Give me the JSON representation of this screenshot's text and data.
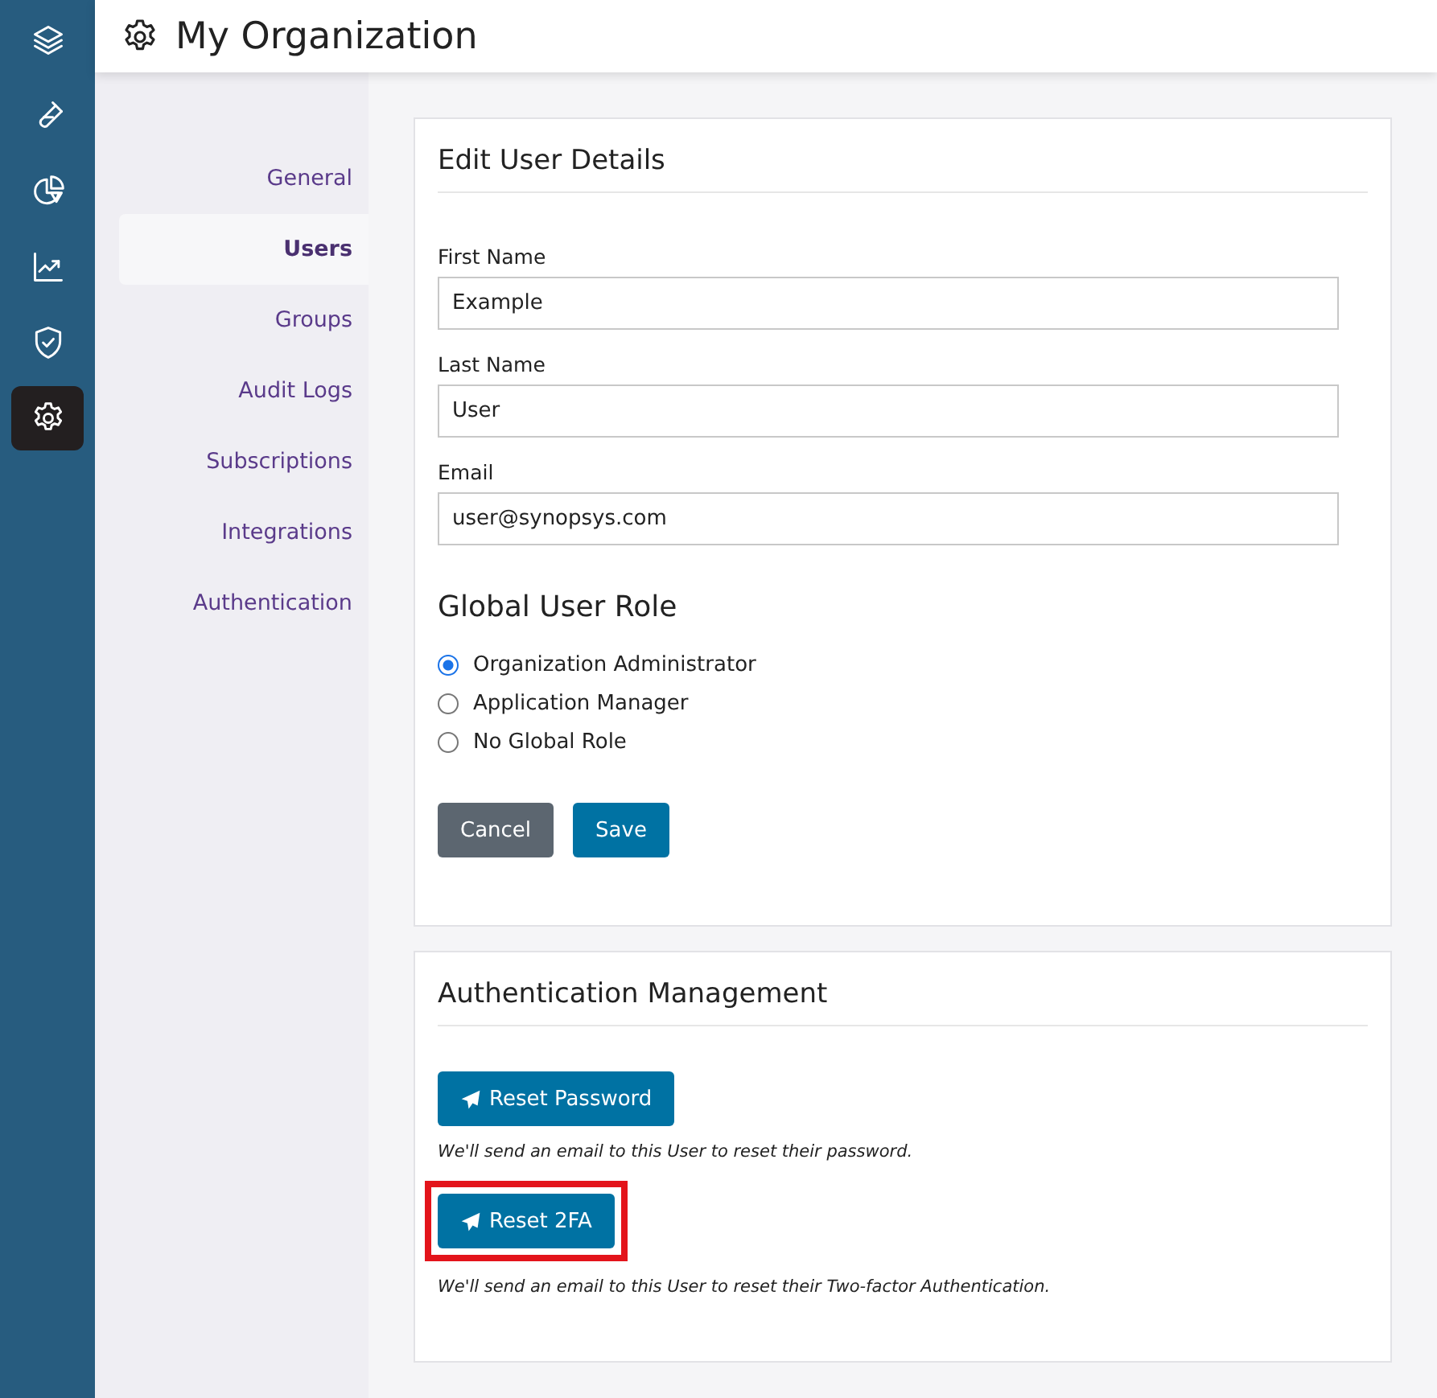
{
  "rail": {
    "items": [
      {
        "kind": "layers",
        "selected": false
      },
      {
        "kind": "flask",
        "selected": false
      },
      {
        "kind": "pie",
        "selected": false
      },
      {
        "kind": "trend",
        "selected": false
      },
      {
        "kind": "shield",
        "selected": false
      },
      {
        "kind": "gear",
        "selected": true
      }
    ]
  },
  "header": {
    "title": "My Organization"
  },
  "subnav": {
    "items": [
      {
        "label": "General",
        "selected": false
      },
      {
        "label": "Users",
        "selected": true
      },
      {
        "label": "Groups",
        "selected": false
      },
      {
        "label": "Audit Logs",
        "selected": false
      },
      {
        "label": "Subscriptions",
        "selected": false
      },
      {
        "label": "Integrations",
        "selected": false
      },
      {
        "label": "Authentication",
        "selected": false
      }
    ]
  },
  "edit_card": {
    "title": "Edit User Details",
    "fields": [
      {
        "label": "First Name",
        "value": "Example"
      },
      {
        "label": "Last Name",
        "value": "User"
      },
      {
        "label": "Email",
        "value": "user@synopsys.com"
      }
    ],
    "role_heading": "Global User Role",
    "roles": [
      {
        "label": "Organization Administrator",
        "selected": true
      },
      {
        "label": "Application Manager",
        "selected": false
      },
      {
        "label": "No Global Role",
        "selected": false
      }
    ],
    "buttons": [
      {
        "label": "Cancel",
        "kind": "secondary"
      },
      {
        "label": "Save",
        "kind": "primary"
      }
    ]
  },
  "auth_card": {
    "title": "Authentication Management",
    "actions": [
      {
        "label": "Reset Password",
        "note": "We'll send an email to this User to reset their password.",
        "highlighted": false
      },
      {
        "label": "Reset 2FA",
        "note": "We'll send an email to this User to reset their Two-factor Authentication.",
        "highlighted": true
      }
    ]
  }
}
